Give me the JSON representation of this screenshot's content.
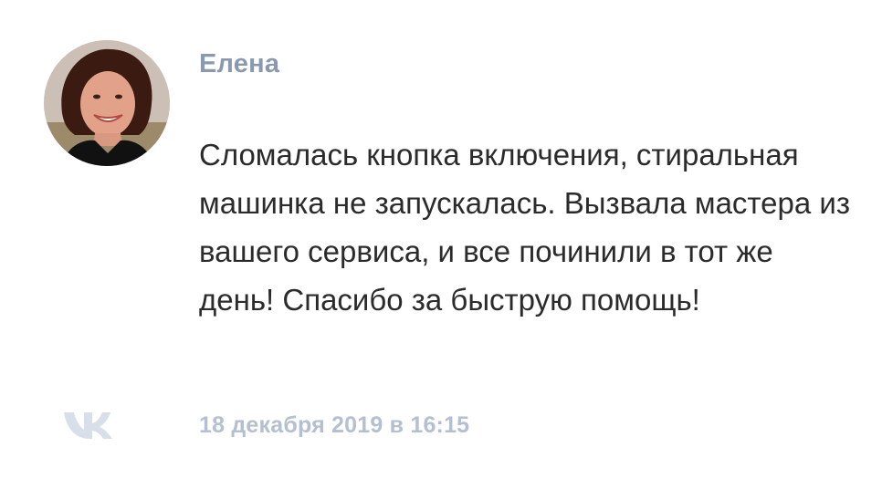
{
  "review": {
    "author_name": "Елена",
    "text": "Сломалась кнопка включения, стиральная машинка не запускалась. Вызвала мастера из вашего сервиса, и все починили в тот же день! Спасибо за быструю помощь!",
    "date": "18 декабря 2019 в 16:15",
    "source_icon": "vk-logo-icon",
    "avatar_icon": "user-avatar-photo"
  },
  "colors": {
    "author": "#8a99b0",
    "text": "#2b2b2b",
    "date": "#b4bfcf",
    "vk_logo": "#d9dfe8"
  }
}
